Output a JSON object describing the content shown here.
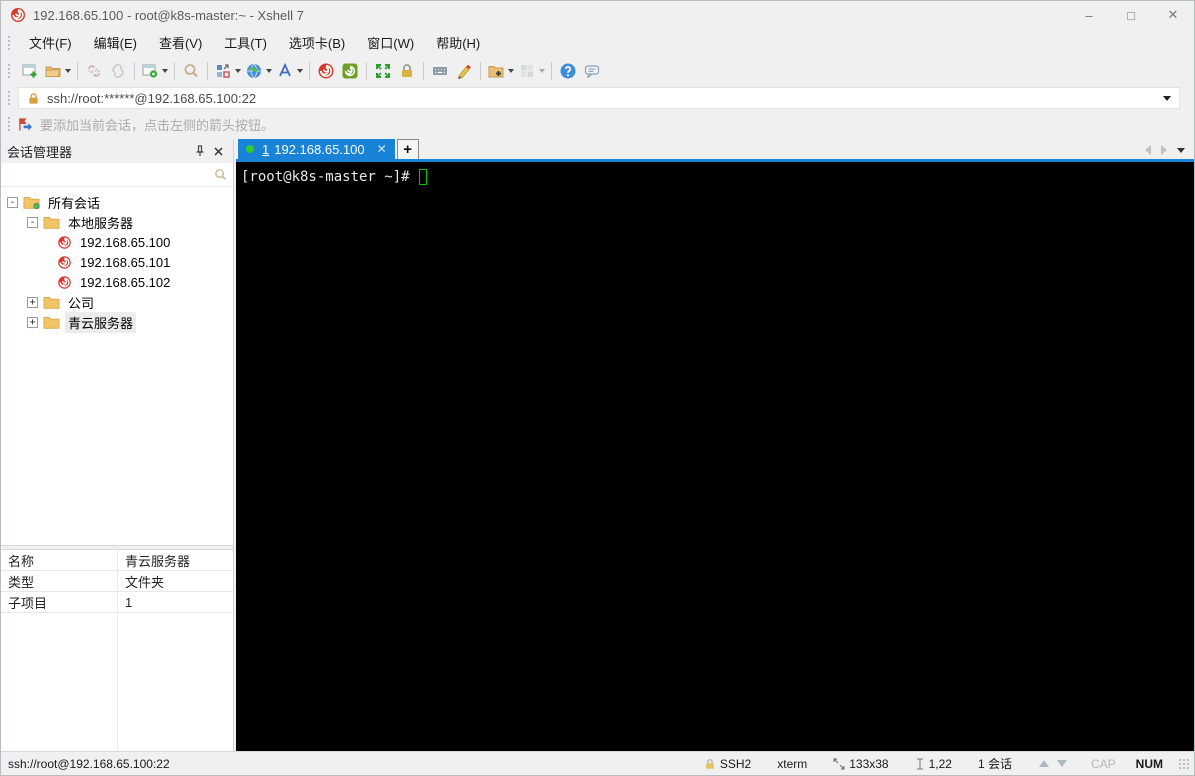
{
  "window": {
    "title": "192.168.65.100 - root@k8s-master:~ - Xshell 7",
    "controls": {
      "minimize": "–",
      "maximize": "□",
      "close": "✕"
    }
  },
  "menu": {
    "items": [
      {
        "label": "文件(F)"
      },
      {
        "label": "编辑(E)"
      },
      {
        "label": "查看(V)"
      },
      {
        "label": "工具(T)"
      },
      {
        "label": "选项卡(B)"
      },
      {
        "label": "窗口(W)"
      },
      {
        "label": "帮助(H)"
      }
    ]
  },
  "toolbar": {
    "icons": [
      "new-session-icon",
      "open-session-icon",
      "disconnect-icon",
      "reconnect-icon",
      "session-properties-icon",
      "find-icon",
      "compose-pane-icon",
      "web-icon",
      "font-icon",
      "xshell-icon",
      "xftp-icon",
      "fullscreen-icon",
      "lock-screen-icon",
      "virtual-keyboard-icon",
      "highlight-icon",
      "new-folder-icon",
      "tile-windows-icon",
      "help-icon",
      "messenger-icon"
    ]
  },
  "addressbar": {
    "value": "ssh://root:******@192.168.65.100:22"
  },
  "infobar": {
    "text": "要添加当前会话，点击左侧的箭头按钮。"
  },
  "sidebar": {
    "title": "会话管理器",
    "search_value": "",
    "tree": [
      {
        "label": "所有会话",
        "expander": "-"
      },
      {
        "label": "本地服务器",
        "expander": "-"
      },
      {
        "label": "192.168.65.100"
      },
      {
        "label": "192.168.65.101"
      },
      {
        "label": "192.168.65.102"
      },
      {
        "label": "公司",
        "expander": "+"
      },
      {
        "label": "青云服务器",
        "expander": "+"
      }
    ],
    "properties": [
      {
        "name": "名称",
        "value": "青云服务器"
      },
      {
        "name": "类型",
        "value": "文件夹"
      },
      {
        "name": "子项目",
        "value": "1"
      }
    ]
  },
  "tabs": {
    "active": {
      "index": "1",
      "label": "192.168.65.100"
    },
    "close_glyph": "✕",
    "new_tab_glyph": "+"
  },
  "terminal": {
    "prompt": "[root@k8s-master ~]# "
  },
  "statusbar": {
    "left": "ssh://root@192.168.65.100:22",
    "protocol": "SSH2",
    "term_type": "xterm",
    "size": "133x38",
    "cursor_pos": "1,22",
    "session_count": "1 会话",
    "cap": "CAP",
    "num": "NUM"
  },
  "colors": {
    "accent_blue": "#1883d7",
    "tab_green_dot": "#2fcb2f",
    "terminal_bg": "#000000",
    "terminal_fg": "#e8e8e8",
    "cursor_green": "#00c200",
    "xshell_red": "#d93a2b",
    "folder_yellow": "#f2c468",
    "ui_gray": "#f0f0f0"
  }
}
